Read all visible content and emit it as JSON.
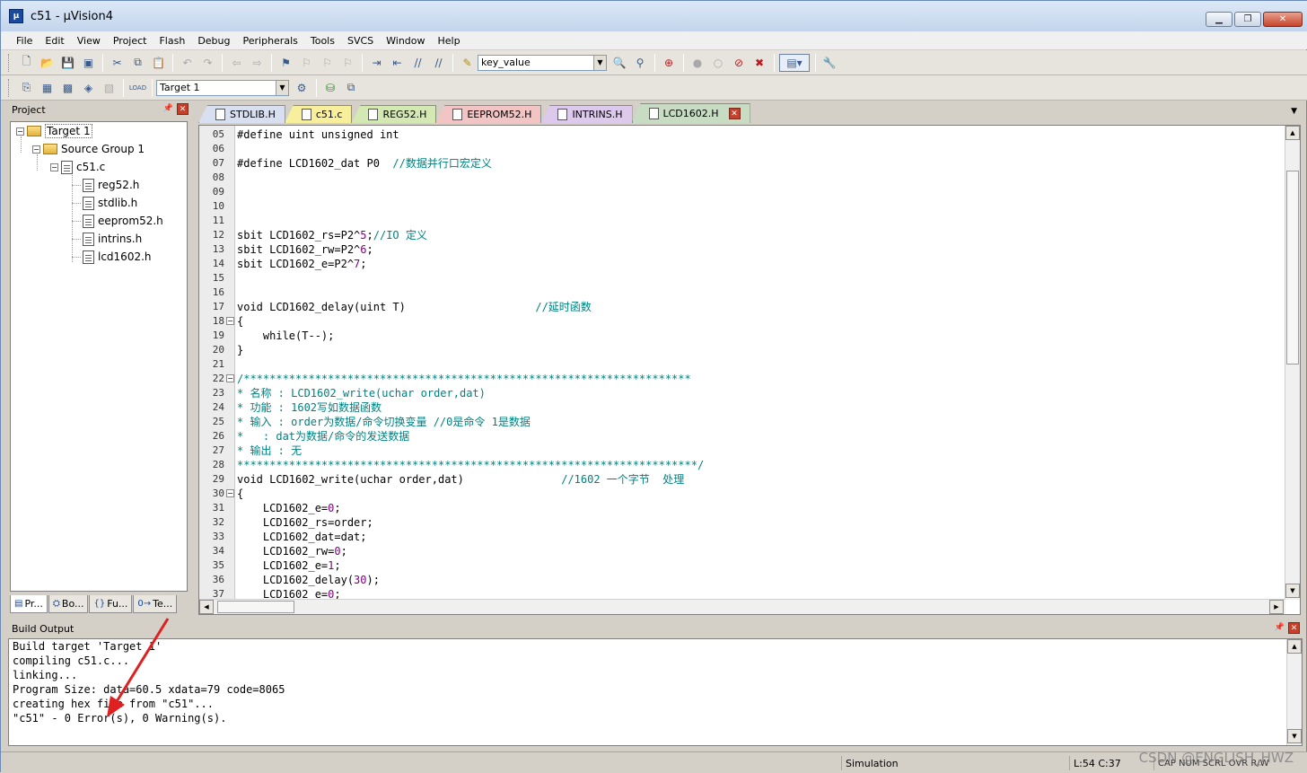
{
  "window": {
    "title": "c51  - µVision4",
    "icon": "uvision-icon"
  },
  "menu": [
    "File",
    "Edit",
    "View",
    "Project",
    "Flash",
    "Debug",
    "Peripherals",
    "Tools",
    "SVCS",
    "Window",
    "Help"
  ],
  "toolbar1": {
    "find_combo_value": "key_value"
  },
  "toolbar2": {
    "target_combo_value": "Target 1"
  },
  "project_panel": {
    "title": "Project",
    "tree": {
      "target": "Target 1",
      "group": "Source Group 1",
      "source": "c51.c",
      "headers": [
        "reg52.h",
        "stdlib.h",
        "eeprom52.h",
        "intrins.h",
        "lcd1602.h"
      ]
    },
    "tabs": [
      "Pr...",
      "Bo...",
      "Fu...",
      "Te..."
    ]
  },
  "editor": {
    "tabs": [
      {
        "label": "STDLIB.H",
        "color": "#d7dff0"
      },
      {
        "label": "c51.c",
        "color": "#f7ef9c"
      },
      {
        "label": "REG52.H",
        "color": "#d4e8b4"
      },
      {
        "label": "EEPROM52.H",
        "color": "#f2c4c4"
      },
      {
        "label": "INTRINS.H",
        "color": "#dcc9ec"
      },
      {
        "label": "LCD1602.H",
        "color": "#c8dcc4"
      }
    ],
    "active_tab": "LCD1602.H",
    "lines": [
      {
        "n": "05",
        "t": "#define uint unsigned int"
      },
      {
        "n": "06",
        "t": ""
      },
      {
        "n": "07",
        "t": "#define LCD1602_dat P0  ",
        "c": "//数据并行口宏定义"
      },
      {
        "n": "08",
        "t": ""
      },
      {
        "n": "09",
        "t": ""
      },
      {
        "n": "10",
        "t": ""
      },
      {
        "n": "11",
        "t": ""
      },
      {
        "n": "12",
        "t": "sbit LCD1602_rs=P2^5;",
        "c": "//IO 定义"
      },
      {
        "n": "13",
        "t": "sbit LCD1602_rw=P2^6;"
      },
      {
        "n": "14",
        "t": "sbit LCD1602_e=P2^7;"
      },
      {
        "n": "15",
        "t": ""
      },
      {
        "n": "16",
        "t": ""
      },
      {
        "n": "17",
        "t": "void LCD1602_delay(uint T)                    ",
        "c": "//延时函数"
      },
      {
        "n": "18",
        "t": "{"
      },
      {
        "n": "19",
        "t": "    while(T--);"
      },
      {
        "n": "20",
        "t": "}"
      },
      {
        "n": "21",
        "t": ""
      },
      {
        "n": "22",
        "t": "",
        "c": "/*********************************************************************"
      },
      {
        "n": "23",
        "t": "",
        "c": "* 名称 : LCD1602_write(uchar order,dat)"
      },
      {
        "n": "24",
        "t": "",
        "c": "* 功能 : 1602写如数据函数"
      },
      {
        "n": "25",
        "t": "",
        "c": "* 输入 : order为数据/命令切换变量 //0是命令 1是数据"
      },
      {
        "n": "26",
        "t": "",
        "c": "*   : dat为数据/命令的发送数据"
      },
      {
        "n": "27",
        "t": "",
        "c": "* 输出 : 无"
      },
      {
        "n": "28",
        "t": "",
        "c": "***********************************************************************/"
      },
      {
        "n": "29",
        "t": "void LCD1602_write(uchar order,dat)               ",
        "c": "//1602 一个字节  处理"
      },
      {
        "n": "30",
        "t": "{"
      },
      {
        "n": "31",
        "t": "    LCD1602_e=0;"
      },
      {
        "n": "32",
        "t": "    LCD1602_rs=order;"
      },
      {
        "n": "33",
        "t": "    LCD1602_dat=dat;"
      },
      {
        "n": "34",
        "t": "    LCD1602_rw=0;"
      },
      {
        "n": "35",
        "t": "    LCD1602_e=1;"
      },
      {
        "n": "36",
        "t": "    LCD1602_delay(30);"
      },
      {
        "n": "37",
        "t": "    LCD1602_e=0;"
      }
    ]
  },
  "build_output": {
    "title": "Build Output",
    "lines": [
      "Build target 'Target 1'",
      "compiling c51.c...",
      "linking...",
      "Program Size: data=60.5 xdata=79 code=8065",
      "creating hex file from \"c51\"...",
      "\"c51\" - 0 Error(s), 0 Warning(s)."
    ]
  },
  "status": {
    "mode": "Simulation",
    "cursor": "L:54 C:37",
    "indicators": "CAP  NUM  SCRL  OVR  R/W"
  },
  "watermark": "CSDN @ENGLISH_HWZ",
  "colors": {
    "comment": "#008080",
    "number": "#800080",
    "arrow": "#e02020"
  }
}
